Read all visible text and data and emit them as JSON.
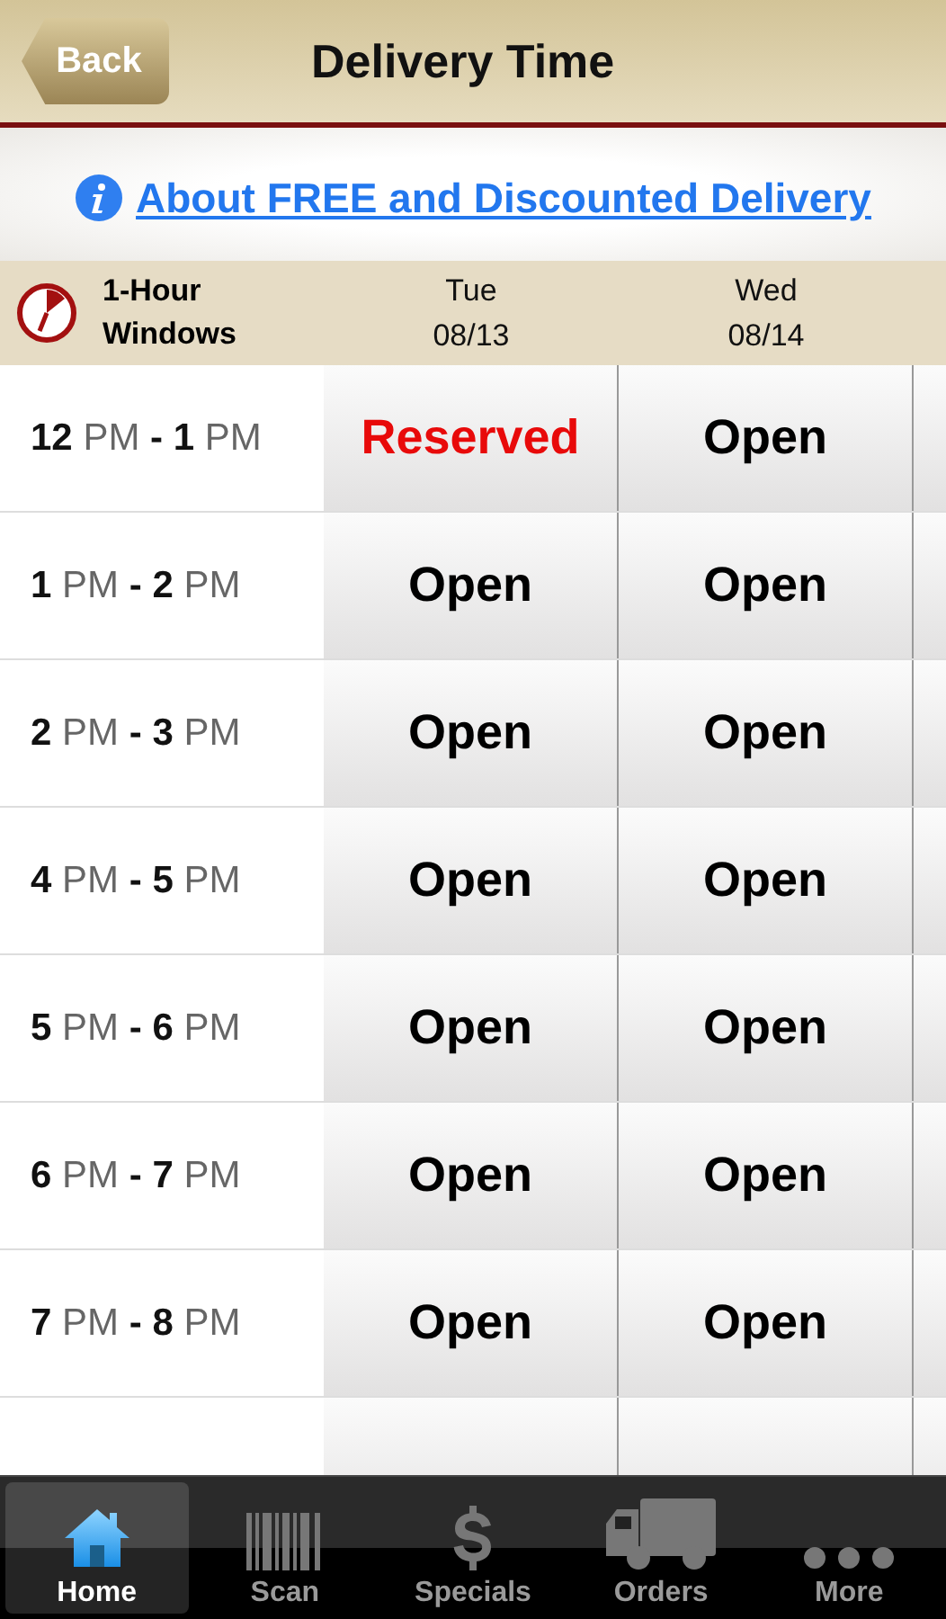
{
  "nav_bar": {
    "back_button": "Back",
    "title": "Delivery Time"
  },
  "info_link": "About FREE and Discounted Delivery",
  "table": {
    "corner_label": "1-Hour Windows",
    "columns": [
      {
        "day": "Tue",
        "date": "08/13"
      },
      {
        "day": "Wed",
        "date": "08/14"
      }
    ],
    "rows": [
      {
        "time": "**12** PM **-** **1** PM",
        "slots": [
          {
            "kind": "reserved",
            "label": "Reserved"
          },
          {
            "kind": "open",
            "label": "Open"
          }
        ]
      },
      {
        "time": "**1** PM **-** **2** PM",
        "slots": [
          {
            "kind": "open",
            "label": "Open"
          },
          {
            "kind": "open",
            "label": "Open"
          }
        ]
      },
      {
        "time": "**2** PM **-** **3** PM",
        "slots": [
          {
            "kind": "open",
            "label": "Open"
          },
          {
            "kind": "open",
            "label": "Open"
          }
        ]
      },
      {
        "time": "**4** PM **-** **5** PM",
        "slots": [
          {
            "kind": "open",
            "label": "Open"
          },
          {
            "kind": "open",
            "label": "Open"
          }
        ]
      },
      {
        "time": "**5** PM **-** **6** PM",
        "slots": [
          {
            "kind": "open",
            "label": "Open"
          },
          {
            "kind": "open",
            "label": "Open"
          }
        ]
      },
      {
        "time": "**6** PM **-** **7** PM",
        "slots": [
          {
            "kind": "open",
            "label": "Open"
          },
          {
            "kind": "open",
            "label": "Open"
          }
        ]
      },
      {
        "time": "**7** PM **-** **8** PM",
        "slots": [
          {
            "kind": "open",
            "label": "Open"
          },
          {
            "kind": "open",
            "label": "Open"
          }
        ]
      }
    ]
  },
  "tab_bar": [
    {
      "kind": "home",
      "label": "Home",
      "selected": true
    },
    {
      "kind": "scan",
      "label": "Scan",
      "selected": false
    },
    {
      "kind": "specials",
      "label": "Specials",
      "selected": false
    },
    {
      "kind": "orders",
      "label": "Orders",
      "selected": false
    },
    {
      "kind": "more",
      "label": "More",
      "selected": false
    }
  ]
}
